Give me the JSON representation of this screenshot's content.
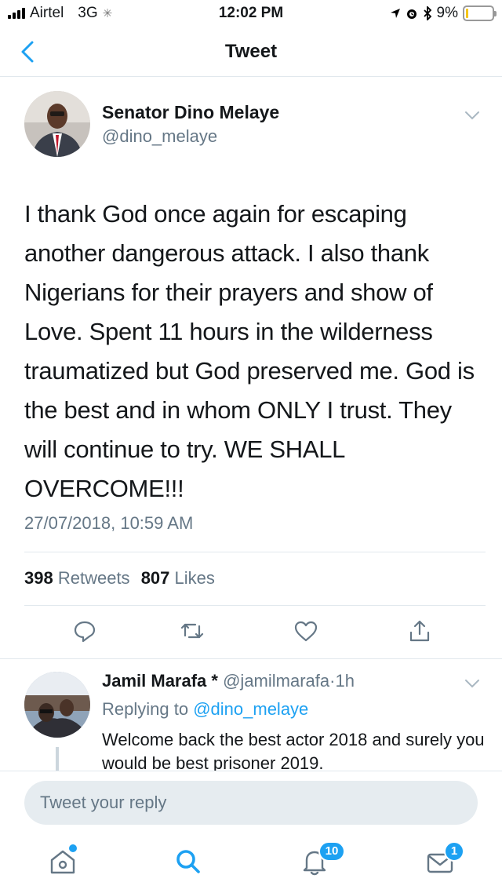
{
  "status_bar": {
    "carrier": "Airtel",
    "network": "3G",
    "time": "12:02 PM",
    "battery_percent": "9%",
    "battery_level": 0.09
  },
  "nav": {
    "title": "Tweet"
  },
  "tweet": {
    "author_name": "Senator Dino Melaye",
    "author_handle": "@dino_melaye",
    "text": "I thank God once again for escaping another dangerous attack. I also thank Nigerians for their prayers and show of Love. Spent 11 hours in the wilderness traumatized but God preserved me. God is the best and in whom ONLY I trust. They will continue to try. WE SHALL OVERCOME!!!",
    "timestamp": "27/07/2018, 10:59 AM",
    "retweets_count": "398",
    "retweets_label": "Retweets",
    "likes_count": "807",
    "likes_label": "Likes"
  },
  "reply": {
    "author_name": "Jamil Marafa *",
    "author_handle": "@jamilmarafa",
    "separator": "·",
    "time_ago": "1h",
    "replying_prefix": "Replying to",
    "replying_to": "@dino_melaye",
    "text": "Welcome back the best actor 2018 and surely you would be best prisoner 2019."
  },
  "composer": {
    "placeholder": "Tweet your reply"
  },
  "tabbar": {
    "notifications_badge": "10",
    "messages_badge": "1"
  },
  "colors": {
    "accent": "#1da1f2",
    "secondary_text": "#657786",
    "divider": "#e1e8ed"
  }
}
